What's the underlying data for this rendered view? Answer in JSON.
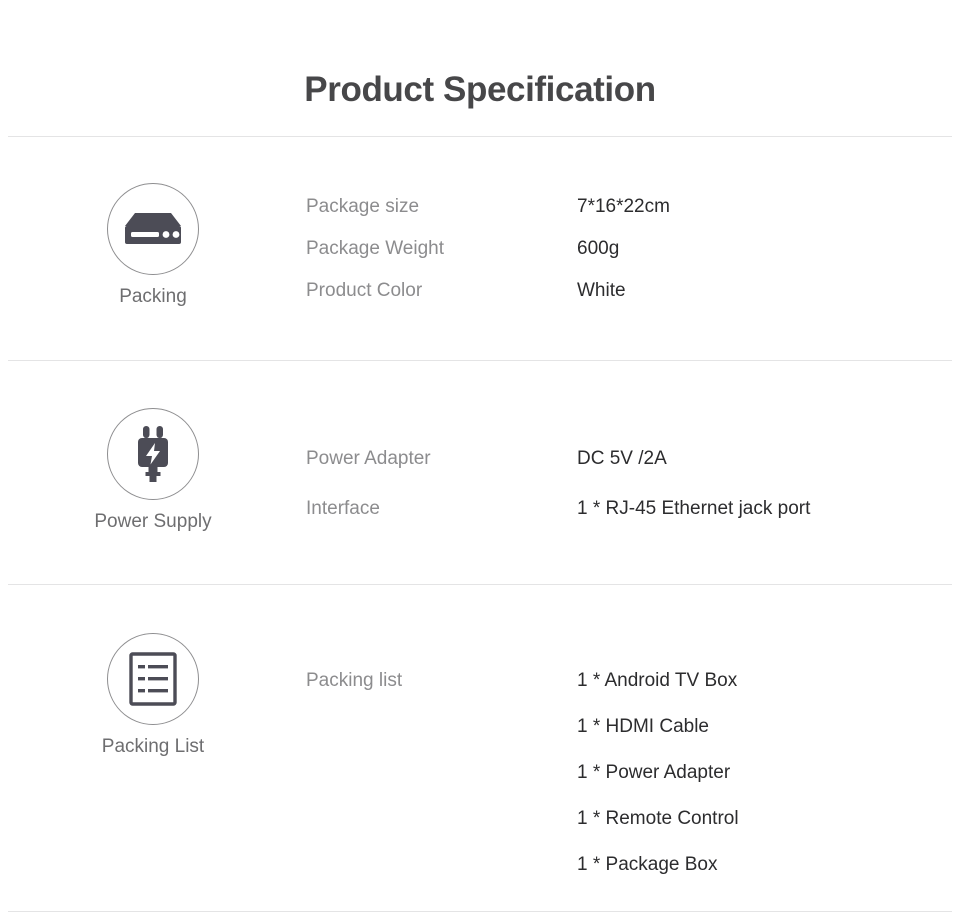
{
  "page": {
    "title": "Product Specification",
    "background": "#ffffff",
    "divider_color": "#e4e4e5",
    "label_color": "#8c8c8e",
    "value_color": "#2c2c2e",
    "icon_stroke_color": "#8e8e90",
    "glyph_color": "#4c4c56",
    "title_color": "#474749"
  },
  "sections": [
    {
      "icon": "set-top-box-icon",
      "caption": "Packing",
      "specs": [
        {
          "label": "Package size",
          "value": "7*16*22cm"
        },
        {
          "label": "Package Weight",
          "value": "600g"
        },
        {
          "label": "Product Color",
          "value": "White"
        }
      ]
    },
    {
      "icon": "power-plug-icon",
      "caption": "Power Supply",
      "specs": [
        {
          "label": "Power Adapter",
          "value": "DC 5V /2A"
        },
        {
          "label": "Interface",
          "value": "1 * RJ-45 Ethernet jack port"
        }
      ]
    },
    {
      "icon": "document-list-icon",
      "caption": "Packing List",
      "specs": [
        {
          "label": "Packing list",
          "value": "1 * Android TV Box"
        }
      ],
      "items": [
        "1 * Android TV Box",
        "1 * HDMI Cable",
        "1 * Power Adapter",
        "1 * Remote Control",
        "1 * Package Box"
      ]
    }
  ]
}
